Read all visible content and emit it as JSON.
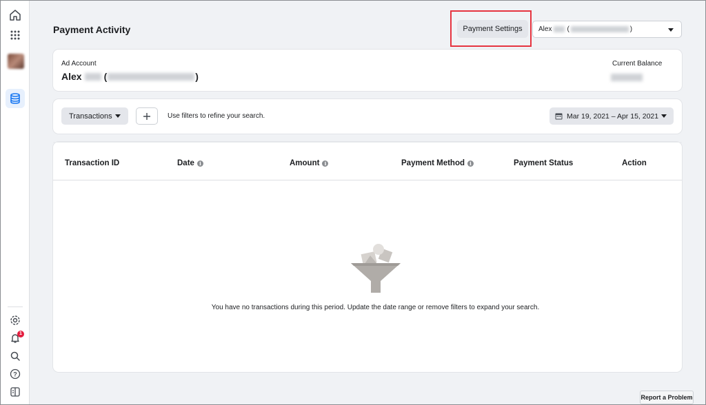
{
  "header": {
    "title": "Payment Activity",
    "payment_settings_label": "Payment Settings",
    "account_selector": {
      "name": "Alex",
      "paren_open": "(",
      "paren_close": ")"
    }
  },
  "account_card": {
    "label": "Ad Account",
    "name": "Alex",
    "paren_open": "(",
    "paren_close": ")",
    "balance_label": "Current Balance"
  },
  "filters": {
    "type_label": "Transactions",
    "hint": "Use filters to refine your search.",
    "date_range": "Mar 19, 2021 – Apr 15, 2021"
  },
  "table": {
    "columns": [
      "Transaction ID",
      "Date",
      "Amount",
      "Payment Method",
      "Payment Status",
      "Action"
    ],
    "info_icon_glyph": "i",
    "empty_message": "You have no transactions during this period. Update the date range or remove filters to expand your search."
  },
  "sidebar": {
    "items": [
      "home-icon",
      "apps-grid-icon",
      "account-avatar",
      "billing-icon",
      "settings-icon",
      "notifications-icon",
      "search-icon",
      "help-icon",
      "panel-toggle-icon"
    ],
    "notification_count": "1"
  },
  "footer": {
    "report_label": "Report a Problem"
  },
  "colors": {
    "accent_blue": "#1877f2",
    "highlight_red": "#e6333f",
    "badge_red": "#e41e3f",
    "funnel_gray": "#b0aca8"
  }
}
